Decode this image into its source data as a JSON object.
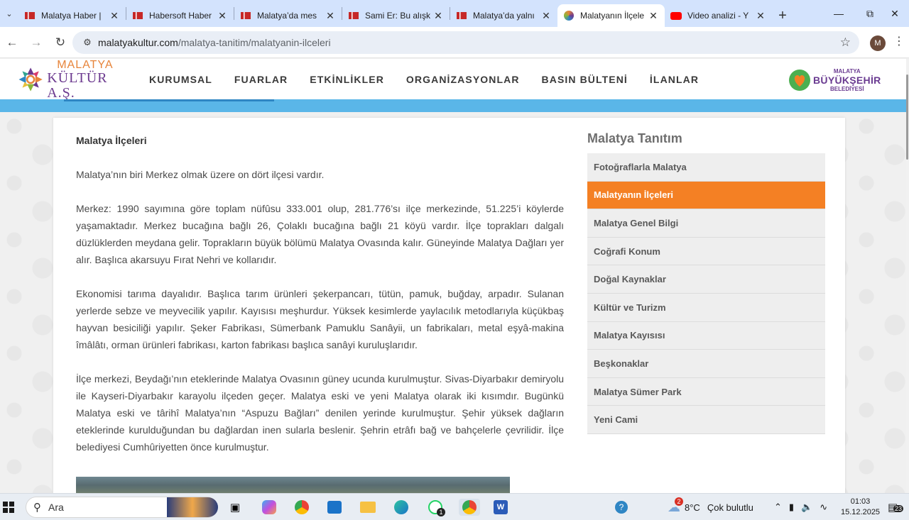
{
  "browser": {
    "tabs": [
      {
        "title": "Malatya Haber |",
        "icon": "news-favicon-icon",
        "active": false
      },
      {
        "title": "Habersoft Haber",
        "icon": "news-favicon-icon",
        "active": false
      },
      {
        "title": "Malatya’da mes",
        "icon": "news-favicon-icon",
        "active": false
      },
      {
        "title": "Sami Er: Bu alışk",
        "icon": "news-favicon-icon",
        "active": false
      },
      {
        "title": "Malatya’da yalnı",
        "icon": "news-favicon-icon",
        "active": false
      },
      {
        "title": "Malatyanın İlçele",
        "icon": "kultur-favicon-icon",
        "active": true
      },
      {
        "title": "Video analizi - Y",
        "icon": "youtube-favicon-icon",
        "active": false
      }
    ],
    "url_host": "malatyakultur.com",
    "url_path": "/malatya-tanitim/malatyanin-ilceleri",
    "profile_initial": "M"
  },
  "site": {
    "logo_line1": "MALATYA",
    "logo_line2": "KÜLTÜR A.Ş.",
    "nav": [
      "KURUMSAL",
      "FUARLAR",
      "ETKİNLİKLER",
      "ORGANİZASYONLAR",
      "BASIN BÜLTENİ",
      "İLANLAR"
    ],
    "partner_logo": {
      "small": "MALATYA",
      "big": "BÜYÜKŞEHİR",
      "sub": "BELEDİYESİ"
    }
  },
  "article": {
    "title": "Malatya İlçeleri",
    "paragraphs": [
      "Malatya’nın biri Merkez olmak üzere on dört ilçesi vardır.",
      "Merkez: 1990 sayımına göre toplam nüfûsu 333.001 olup, 281.776’sı ilçe merkezinde, 51.225’i köylerde yaşamaktadır. Merkez bucağına bağlı 26, Çolaklı bucağına bağlı 21 köyü vardır. İlçe toprakları dalgalı düzlüklerden meydana gelir. Toprakların büyük bölümü Malatya Ovasında kalır. Güneyinde Malatya Dağları yer alır. Başlıca akarsuyu Fırat Nehri ve kollarıdır.",
      "Ekonomisi tarıma dayalıdır. Başlıca tarım ürünleri şekerpancarı, tütün, pamuk, buğday, arpadır. Sulanan yerlerde sebze ve meyvecilik yapılır. Kayısısı meşhurdur. Yüksek kesimlerde yaylacılık metodlarıyla küçükbaş hayvan besiciliği yapılır. Şeker Fabrikası, Sümerbank Pamuklu Sanâyii, un fabrikaları, metal eşyâ-makina îmâlâtı, orman ürünleri fabrikası, karton fabrikası başlıca sanâyi kuruluşlarıdır.",
      "İlçe merkezi, Beydağı’nın eteklerinde Malatya Ovasının güney ucunda kurulmuştur. Sivas-Diyarbakır demiryolu ile Kayseri-Diyarbakır karayolu ilçeden geçer. Malatya eski ve yeni Malatya olarak iki kısımdır. Bugünkü Malatya eski ve târihî Malatya’nın “Aspuzu Bağları” denilen yerinde kurulmuştur. Şehir yüksek dağların eteklerinde kurulduğundan bu dağlardan inen sularla beslenir. Şehrin etrâfı bağ ve bahçelerle çevrilidir. İlçe belediyesi Cumhûriyetten önce kurulmuştur."
    ]
  },
  "sidebar": {
    "title": "Malatya Tanıtım",
    "items": [
      {
        "label": "Fotoğraflarla Malatya",
        "active": false
      },
      {
        "label": "Malatyanın İlçeleri",
        "active": true
      },
      {
        "label": "Malatya Genel Bilgi",
        "active": false
      },
      {
        "label": "Coğrafi Konum",
        "active": false
      },
      {
        "label": "Doğal Kaynaklar",
        "active": false
      },
      {
        "label": "Kültür ve Turizm",
        "active": false
      },
      {
        "label": "Malatya Kayısısı",
        "active": false
      },
      {
        "label": "Beşkonaklar",
        "active": false
      },
      {
        "label": "Malatya Sümer Park",
        "active": false
      },
      {
        "label": "Yeni Cami",
        "active": false
      }
    ]
  },
  "taskbar": {
    "search_label": "Ara",
    "weather_temp": "8°C",
    "weather_text": "Çok bulutlu",
    "weather_badge": "2",
    "time": "01:03",
    "date": "15.12.2025",
    "notification_count": "23",
    "chrome_badge": "1"
  },
  "colors": {
    "accent_orange": "#f48024",
    "header_blue": "#5ab6e8",
    "tab_strip": "#d3e3fd"
  }
}
